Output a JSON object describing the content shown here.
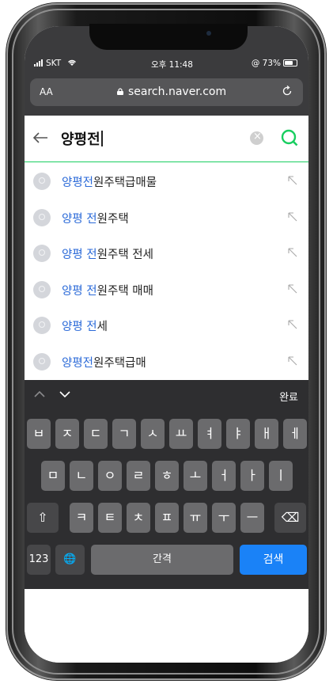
{
  "status": {
    "carrier": "SKT",
    "time": "오후 11:48",
    "battery": "73%"
  },
  "browser": {
    "text_size": "AA",
    "url": "search.naver.com"
  },
  "search": {
    "query": "양평전"
  },
  "suggestions": [
    {
      "hl": "양평전",
      "rest": "원주택급매물"
    },
    {
      "hl": "양평 전",
      "rest": "원주택"
    },
    {
      "hl": "양평 전",
      "rest": "원주택 전세"
    },
    {
      "hl": "양평 전",
      "rest": "원주택 매매"
    },
    {
      "hl": "양평 전",
      "rest": "세"
    },
    {
      "hl": "양평전",
      "rest": "원주택급매"
    }
  ],
  "keyboard": {
    "done": "완료",
    "row1": [
      "ㅂ",
      "ㅈ",
      "ㄷ",
      "ㄱ",
      "ㅅ",
      "ㅛ",
      "ㅕ",
      "ㅑ",
      "ㅐ",
      "ㅔ"
    ],
    "row2": [
      "ㅁ",
      "ㄴ",
      "ㅇ",
      "ㄹ",
      "ㅎ",
      "ㅗ",
      "ㅓ",
      "ㅏ",
      "ㅣ"
    ],
    "row3": [
      "ㅋ",
      "ㅌ",
      "ㅊ",
      "ㅍ",
      "ㅠ",
      "ㅜ",
      "ㅡ"
    ],
    "shift": "⇧",
    "delete": "⌫",
    "numbers": "123",
    "globe": "🌐",
    "space": "간격",
    "search": "검색"
  },
  "colors": {
    "accent": "#19ce60",
    "highlight": "#2b6ad8",
    "search_key": "#1a82f7"
  }
}
